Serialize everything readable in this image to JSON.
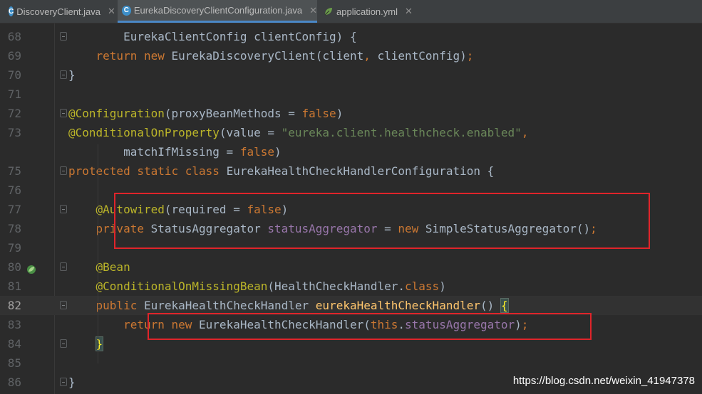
{
  "tabs": [
    {
      "label": "DiscoveryClient.java",
      "icon": "java-class-icon",
      "icon_glyph": "C",
      "active": false
    },
    {
      "label": "EurekaDiscoveryClientConfiguration.java",
      "icon": "java-class-icon",
      "icon_glyph": "C",
      "active": true
    },
    {
      "label": "application.yml",
      "icon": "yaml-leaf-icon",
      "icon_glyph": "",
      "active": false
    }
  ],
  "close_glyph": "✕",
  "current_line": "82",
  "lines": [
    {
      "num": "68",
      "segs": [
        [
          "        EurekaClientConfig clientConfig) {",
          ""
        ]
      ]
    },
    {
      "num": "69",
      "segs": [
        [
          "    ",
          ""
        ],
        [
          "return new ",
          "k"
        ],
        [
          "EurekaDiscoveryClient(client",
          ""
        ],
        [
          ", ",
          "k"
        ],
        [
          "clientConfig)",
          ""
        ],
        [
          ";",
          "k"
        ]
      ]
    },
    {
      "num": "70",
      "segs": [
        [
          "}",
          ""
        ]
      ]
    },
    {
      "num": "71",
      "segs": []
    },
    {
      "num": "72",
      "segs": [
        [
          "@Configuration",
          "a"
        ],
        [
          "(proxyBeanMethods = ",
          ""
        ],
        [
          "false",
          "k"
        ],
        [
          ")",
          ""
        ]
      ]
    },
    {
      "num": "73",
      "segs": [
        [
          "@ConditionalOnProperty",
          "a"
        ],
        [
          "(value = ",
          ""
        ],
        [
          "\"eureka.client.healthcheck.enabled\"",
          "s"
        ],
        [
          ",",
          "k"
        ]
      ]
    },
    {
      "num": "",
      "segs": [
        [
          "        matchIfMissing = ",
          ""
        ],
        [
          "false",
          "k"
        ],
        [
          ")",
          ""
        ]
      ]
    },
    {
      "num": "75",
      "segs": [
        [
          "protected static class ",
          "k"
        ],
        [
          "EurekaHealthCheckHandlerConfiguration {",
          ""
        ]
      ]
    },
    {
      "num": "76",
      "segs": []
    },
    {
      "num": "77",
      "segs": [
        [
          "    ",
          ""
        ],
        [
          "@Autowired",
          "a"
        ],
        [
          "(required = ",
          ""
        ],
        [
          "false",
          "k"
        ],
        [
          ")",
          ""
        ]
      ]
    },
    {
      "num": "78",
      "segs": [
        [
          "    ",
          ""
        ],
        [
          "private ",
          "k"
        ],
        [
          "StatusAggregator ",
          ""
        ],
        [
          "statusAggregator",
          "f"
        ],
        [
          " = ",
          ""
        ],
        [
          "new ",
          "k"
        ],
        [
          "SimpleStatusAggregator()",
          ""
        ],
        [
          ";",
          "k"
        ]
      ]
    },
    {
      "num": "79",
      "segs": []
    },
    {
      "num": "80",
      "segs": [
        [
          "    ",
          ""
        ],
        [
          "@Bean",
          "a"
        ]
      ]
    },
    {
      "num": "81",
      "segs": [
        [
          "    ",
          ""
        ],
        [
          "@ConditionalOnMissingBean",
          "a"
        ],
        [
          "(HealthCheckHandler.",
          ""
        ],
        [
          "class",
          "k"
        ],
        [
          ")",
          ""
        ]
      ]
    },
    {
      "num": "82",
      "segs": [
        [
          "    ",
          ""
        ],
        [
          "public ",
          "k"
        ],
        [
          "EurekaHealthCheckHandler ",
          ""
        ],
        [
          "eurekaHealthCheckHandler",
          "m"
        ],
        [
          "() ",
          ""
        ],
        [
          "{",
          "brace"
        ]
      ]
    },
    {
      "num": "83",
      "segs": [
        [
          "        ",
          ""
        ],
        [
          "return new ",
          "k"
        ],
        [
          "EurekaHealthCheckHandler(",
          ""
        ],
        [
          "this",
          "k"
        ],
        [
          ".",
          ""
        ],
        [
          "statusAggregator",
          "f"
        ],
        [
          ")",
          ""
        ],
        [
          ";",
          "k"
        ]
      ]
    },
    {
      "num": "84",
      "segs": [
        [
          "    ",
          ""
        ],
        [
          "}",
          "brace"
        ]
      ]
    },
    {
      "num": "85",
      "segs": []
    },
    {
      "num": "86",
      "segs": [
        [
          "}",
          ""
        ]
      ]
    }
  ],
  "watermark": "https://blog.csdn.net/weixin_41947378"
}
